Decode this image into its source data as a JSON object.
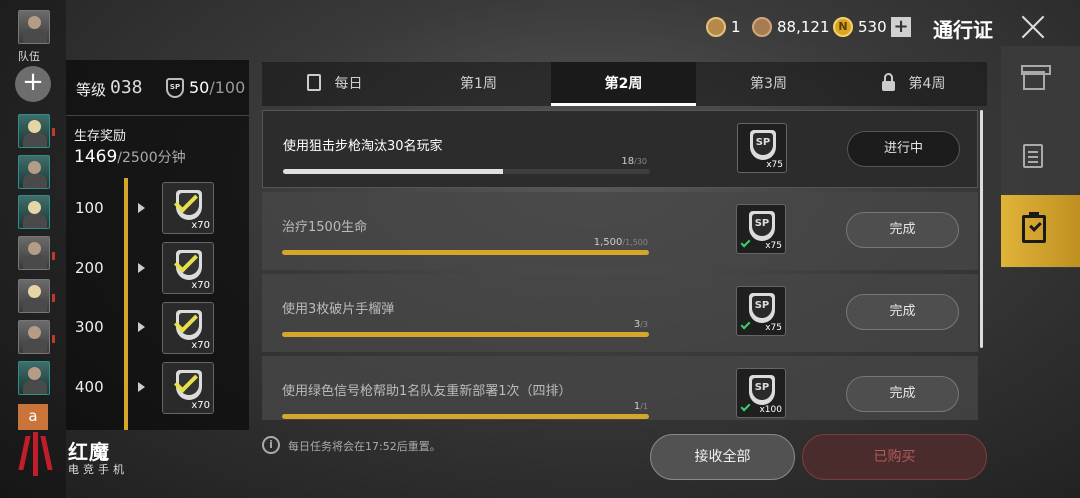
{
  "squad": {
    "label": "队伍",
    "add": "+",
    "extra_badge": "a"
  },
  "level": {
    "label": "等级",
    "value": "038",
    "sp_icon": "SP",
    "sp_current": "50",
    "sp_max": "/100"
  },
  "survival": {
    "label": "生存奖励",
    "current": "1469",
    "total": "/2500分钟"
  },
  "tiers": [
    {
      "threshold": "100",
      "qty": "x70"
    },
    {
      "threshold": "200",
      "qty": "x70"
    },
    {
      "threshold": "300",
      "qty": "x70"
    },
    {
      "threshold": "400",
      "qty": "x70"
    }
  ],
  "currency": {
    "rank": "1",
    "coins": "88,121",
    "n_icon": "N",
    "n_value": "530",
    "plus": "+"
  },
  "title": "通行证",
  "tabs": [
    "每日",
    "第1周",
    "第2周",
    "第3周",
    "第4周"
  ],
  "active_tab": "第2周",
  "missions": [
    {
      "title": "使用狙击步枪淘汰30名玩家",
      "progress": "18",
      "goal": "/30",
      "fraction": 0.6,
      "reward": "SP",
      "qty": "x75",
      "button": "进行中",
      "done": false
    },
    {
      "title": "治疗1500生命",
      "progress": "1,500",
      "goal": "/1,500",
      "fraction": 1,
      "reward": "SP",
      "qty": "x75",
      "button": "完成",
      "done": true
    },
    {
      "title": "使用3枚破片手榴弹",
      "progress": "3",
      "goal": "/3",
      "fraction": 1,
      "reward": "SP",
      "qty": "x75",
      "button": "完成",
      "done": true
    },
    {
      "title": "使用绿色信号枪帮助1名队友重新部署1次（四排）",
      "progress": "1",
      "goal": "/1",
      "fraction": 1,
      "reward": "SP",
      "qty": "x100",
      "button": "完成",
      "done": true
    }
  ],
  "footer": {
    "info_icon": "i",
    "notice": "每日任务将会在17:52后重置。",
    "claim_all": "接收全部",
    "purchased": "已购买"
  },
  "watermark": {
    "line1": "红魔",
    "line2": "电竞手机"
  },
  "colors": {
    "accent": "#d4a72c",
    "done_check": "#3bd16f",
    "purchased": "#b35a5a"
  }
}
